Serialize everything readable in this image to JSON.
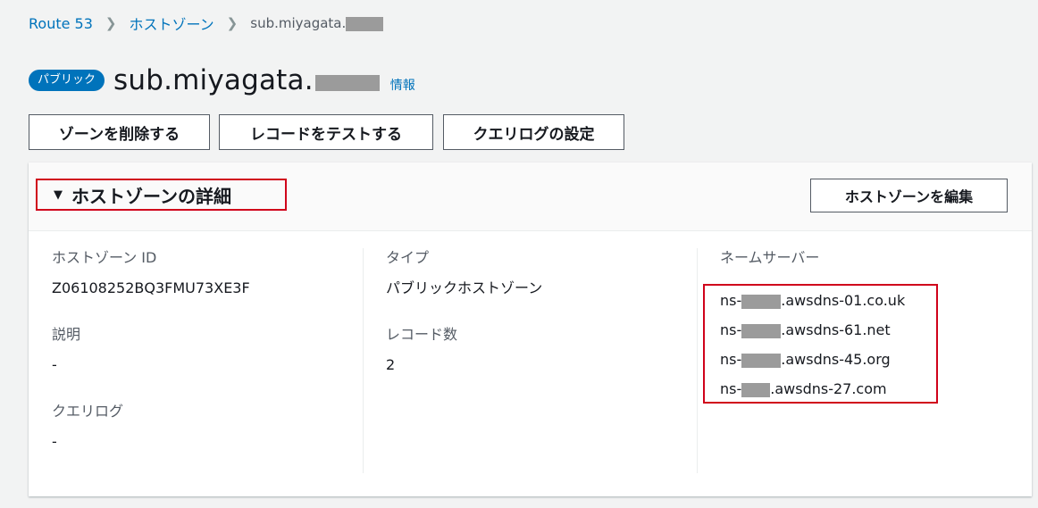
{
  "breadcrumb": {
    "items": [
      "Route 53",
      "ホストゾーン"
    ],
    "current": "sub.miyagata."
  },
  "header": {
    "badge": "パブリック",
    "title": "sub.miyagata.",
    "info": "情報"
  },
  "actions": {
    "delete_zone": "ゾーンを削除する",
    "test_record": "レコードをテストする",
    "query_log": "クエリログの設定"
  },
  "details": {
    "section_title": "ホストゾーンの詳細",
    "edit_button": "ホストゾーンを編集",
    "hosted_zone_id_label": "ホストゾーン ID",
    "hosted_zone_id": "Z06108252BQ3FMU73XE3F",
    "description_label": "説明",
    "description": "-",
    "query_log_label": "クエリログ",
    "query_log": "-",
    "type_label": "タイプ",
    "type": "パブリックホストゾーン",
    "record_count_label": "レコード数",
    "record_count": "2",
    "name_servers_label": "ネームサーバー",
    "name_servers": [
      {
        "prefix": "ns-",
        "suffix": ".awsdns-01.co.uk"
      },
      {
        "prefix": "ns-",
        "suffix": ".awsdns-61.net"
      },
      {
        "prefix": "ns-",
        "suffix": ".awsdns-45.org"
      },
      {
        "prefix": "ns-",
        "suffix": ".awsdns-27.com"
      }
    ]
  },
  "colors": {
    "link": "#0073bb",
    "highlight": "#d0021b",
    "redaction": "#9b9b9b"
  }
}
